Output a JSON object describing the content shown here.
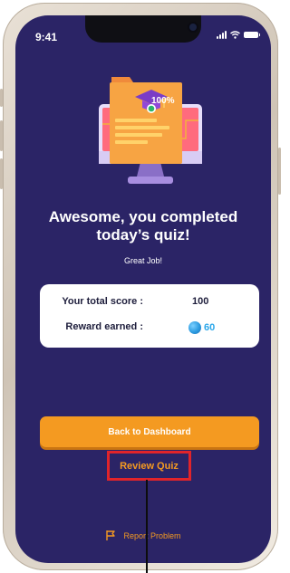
{
  "status_bar": {
    "time": "9:41"
  },
  "illustration": {
    "badge_text": "100%",
    "icon": "graduation-cap-monitor-icon"
  },
  "result": {
    "headline_line1": "Awesome, you completed",
    "headline_line2": "today’s quiz!",
    "subtitle": "Great Job!"
  },
  "score_card": {
    "total_score_label": "Your total score :",
    "total_score_value": "100",
    "reward_label": "Reward earned :",
    "reward_value": "60",
    "reward_icon": "coin-icon"
  },
  "actions": {
    "back_label": "Back to Dashboard",
    "review_label": "Review Quiz",
    "report_label": "Report Problem"
  },
  "colors": {
    "screen_bg": "#2b2466",
    "accent_orange": "#f49a21",
    "highlight_red": "#e1242a",
    "reward_blue": "#2ba7ea"
  }
}
